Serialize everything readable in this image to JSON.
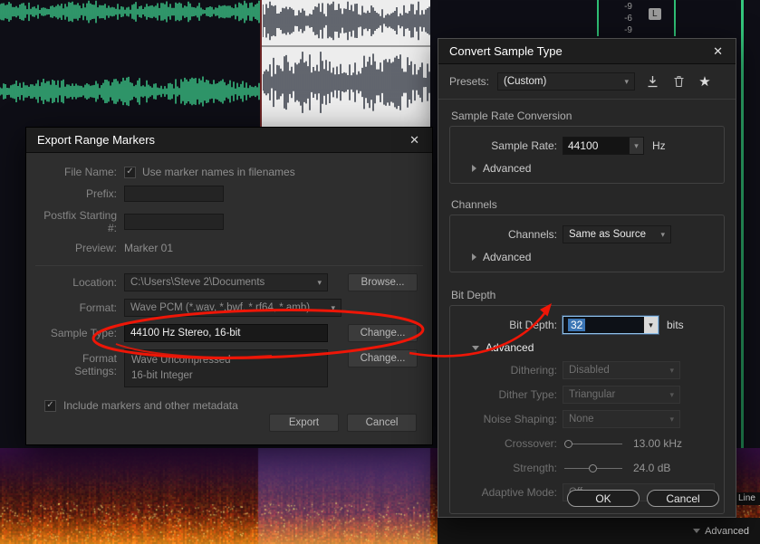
{
  "icons": {
    "close": "✕",
    "caret": "▾",
    "check": "✓",
    "star": "★"
  },
  "background": {
    "meter_scale": [
      "-9",
      "-6",
      "-9"
    ],
    "left_channel_badge": "L",
    "bottom_right_line_label": "Line",
    "bottom_right_advanced_label": "Advanced"
  },
  "export_dialog": {
    "title": "Export Range Markers",
    "file_name_label": "File Name:",
    "use_marker_names_label": "Use marker names in filenames",
    "prefix_label": "Prefix:",
    "postfix_label": "Postfix Starting #:",
    "preview_label": "Preview:",
    "preview_value": "Marker 01",
    "location_label": "Location:",
    "location_value": "C:\\Users\\Steve 2\\Documents",
    "browse_button": "Browse...",
    "format_label": "Format:",
    "format_value": "Wave PCM (*.wav, *.bwf, *.rf64, *.amb)",
    "sample_type_label": "Sample Type:",
    "sample_type_value": "44100 Hz Stereo, 16-bit",
    "sample_type_change_button": "Change...",
    "format_settings_label": "Format Settings:",
    "format_settings_line1": "Wave Uncompressed",
    "format_settings_line2": "16-bit Integer",
    "format_settings_change_button": "Change...",
    "include_metadata_label": "Include markers and other metadata",
    "export_button": "Export",
    "cancel_button": "Cancel"
  },
  "convert_dialog": {
    "title": "Convert Sample Type",
    "presets_label": "Presets:",
    "presets_value": "(Custom)",
    "sample_rate_section": {
      "heading": "Sample Rate Conversion",
      "sample_rate_label": "Sample Rate:",
      "sample_rate_value": "44100",
      "unit": "Hz",
      "advanced_label": "Advanced"
    },
    "channels_section": {
      "heading": "Channels",
      "channels_label": "Channels:",
      "channels_value": "Same as Source",
      "advanced_label": "Advanced"
    },
    "bit_depth_section": {
      "heading": "Bit Depth",
      "bit_depth_label": "Bit Depth:",
      "bit_depth_value": "32",
      "unit": "bits",
      "advanced_label": "Advanced",
      "dithering_label": "Dithering:",
      "dithering_value": "Disabled",
      "dither_type_label": "Dither Type:",
      "dither_type_value": "Triangular",
      "noise_shaping_label": "Noise Shaping:",
      "noise_shaping_value": "None",
      "crossover_label": "Crossover:",
      "crossover_value": "13.00 kHz",
      "strength_label": "Strength:",
      "strength_value": "24.0 dB",
      "adaptive_mode_label": "Adaptive Mode:",
      "adaptive_mode_value": "Off"
    },
    "ok_button": "OK",
    "cancel_button": "Cancel"
  }
}
